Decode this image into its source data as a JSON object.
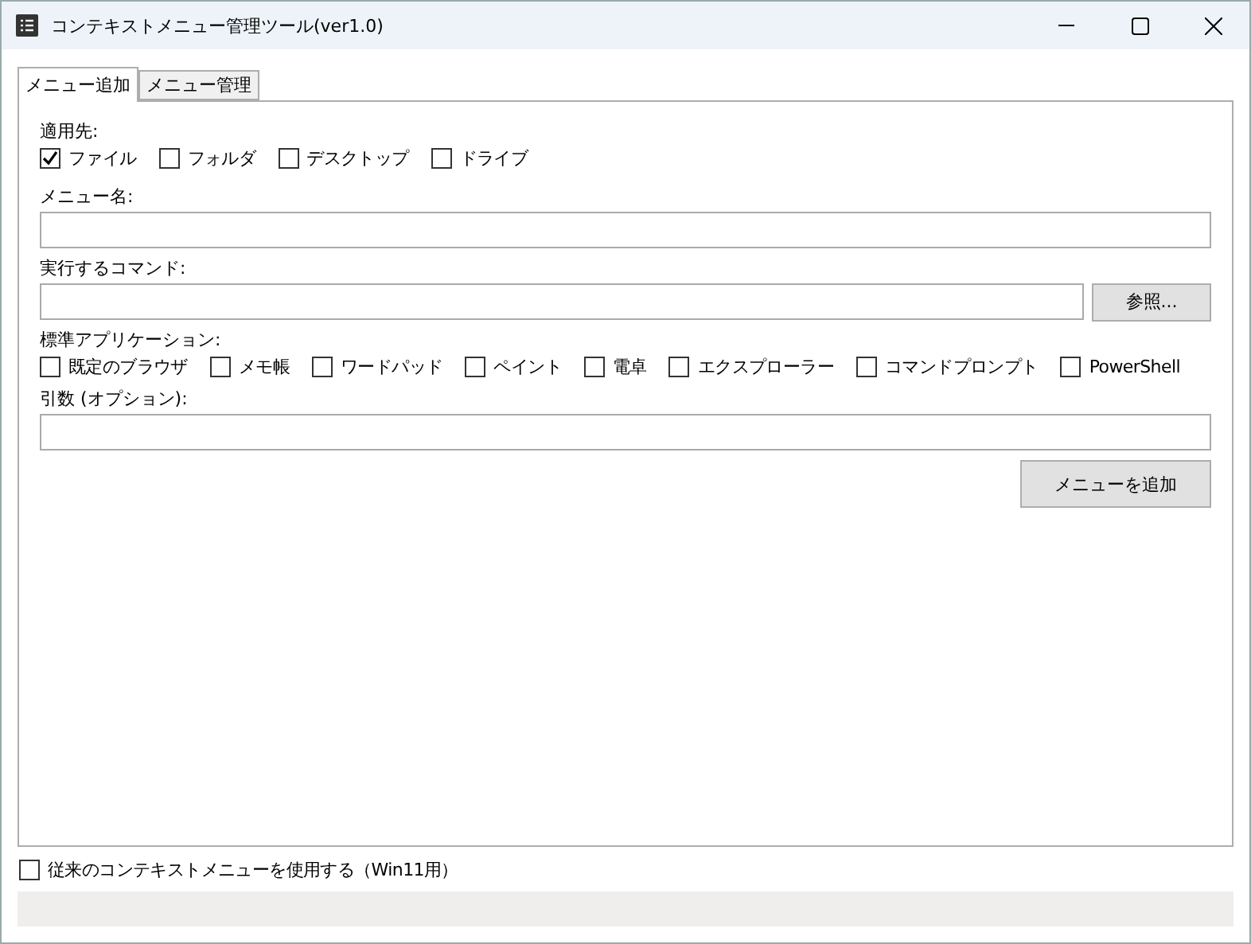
{
  "window": {
    "title": "コンテキストメニュー管理ツール(ver1.0)"
  },
  "tabs": [
    {
      "label": "メニュー追加",
      "selected": true
    },
    {
      "label": "メニュー管理",
      "selected": false
    }
  ],
  "target": {
    "label": "適用先:",
    "options": [
      {
        "label": "ファイル",
        "checked": true
      },
      {
        "label": "フォルダ",
        "checked": false
      },
      {
        "label": "デスクトップ",
        "checked": false
      },
      {
        "label": "ドライブ",
        "checked": false
      }
    ]
  },
  "menu_name": {
    "label": "メニュー名:"
  },
  "command": {
    "label": "実行するコマンド:",
    "browse_button": "参照..."
  },
  "standard_apps": {
    "label": "標準アプリケーション:",
    "options": [
      {
        "label": "既定のブラウザ",
        "checked": false
      },
      {
        "label": "メモ帳",
        "checked": false
      },
      {
        "label": "ワードパッド",
        "checked": false
      },
      {
        "label": "ペイント",
        "checked": false
      },
      {
        "label": "電卓",
        "checked": false
      },
      {
        "label": "エクスプローラー",
        "checked": false
      },
      {
        "label": "コマンドプロンプト",
        "checked": false
      },
      {
        "label": "PowerShell",
        "checked": false
      }
    ]
  },
  "arguments": {
    "label": "引数 (オプション):"
  },
  "add_button": "メニューを追加",
  "legacy_menu": {
    "label": "従来のコンテキストメニューを使用する（Win11用）",
    "checked": false
  }
}
